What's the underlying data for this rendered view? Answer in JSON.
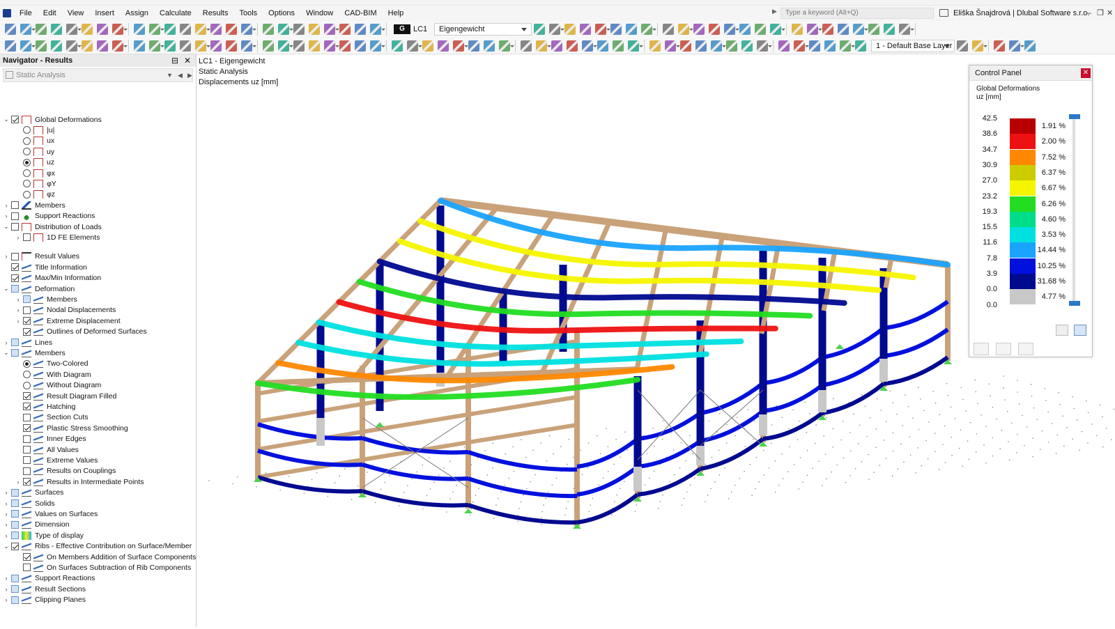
{
  "menubar": {
    "items": [
      "File",
      "Edit",
      "View",
      "Insert",
      "Assign",
      "Calculate",
      "Results",
      "Tools",
      "Options",
      "Window",
      "CAD-BIM",
      "Help"
    ],
    "search_placeholder": "Type a keyword (Alt+Q)",
    "user": "Eliška Šnajdrová | Dlubal Software s.r.o."
  },
  "toolbar": {
    "lc_group": "G",
    "lc_code": "LC1",
    "lc_name": "Eigengewicht",
    "layer": "1 - Default Base Layer"
  },
  "navigator": {
    "title": "Navigator - Results",
    "analysis": "Static Analysis",
    "tree": [
      {
        "label": "Global Deformations",
        "level": 0,
        "exp": "v",
        "ctl": "cb-on",
        "icon": "deform"
      },
      {
        "label": "|u|",
        "level": 1,
        "exp": "",
        "ctl": "rb",
        "icon": "deform"
      },
      {
        "label": "ux",
        "level": 1,
        "exp": "",
        "ctl": "rb",
        "icon": "deform"
      },
      {
        "label": "uy",
        "level": 1,
        "exp": "",
        "ctl": "rb",
        "icon": "deform"
      },
      {
        "label": "uz",
        "level": 1,
        "exp": "",
        "ctl": "rb-on",
        "icon": "deform"
      },
      {
        "label": "φx",
        "level": 1,
        "exp": "",
        "ctl": "rb",
        "icon": "deform"
      },
      {
        "label": "φY",
        "level": 1,
        "exp": "",
        "ctl": "rb",
        "icon": "deform"
      },
      {
        "label": "φz",
        "level": 1,
        "exp": "",
        "ctl": "rb",
        "icon": "deform"
      },
      {
        "label": "Members",
        "level": 0,
        "exp": ">",
        "ctl": "cb",
        "icon": "mem"
      },
      {
        "label": "Support Reactions",
        "level": 0,
        "exp": ">",
        "ctl": "cb",
        "icon": "supp"
      },
      {
        "label": "Distribution of Loads",
        "level": 0,
        "exp": "v",
        "ctl": "cb",
        "icon": "deform"
      },
      {
        "label": "1D FE Elements",
        "level": 1,
        "exp": ">",
        "ctl": "cb",
        "icon": "deform"
      },
      {
        "label": "Result Values",
        "level": 0,
        "exp": ">",
        "ctl": "cb",
        "icon": "rv",
        "gap": true
      },
      {
        "label": "Title Information",
        "level": 0,
        "exp": "",
        "ctl": "cb-on",
        "icon": "gen"
      },
      {
        "label": "Max/Min Information",
        "level": 0,
        "exp": "",
        "ctl": "cb-on",
        "icon": "gen"
      },
      {
        "label": "Deformation",
        "level": 0,
        "exp": "v",
        "ctl": "cb-mixed",
        "icon": "gen"
      },
      {
        "label": "Members",
        "level": 1,
        "exp": ">",
        "ctl": "cb-mixed",
        "icon": "gen"
      },
      {
        "label": "Nodal Displacements",
        "level": 1,
        "exp": ">",
        "ctl": "cb",
        "icon": "gen"
      },
      {
        "label": "Extreme Displacement",
        "level": 1,
        "exp": ">",
        "ctl": "cb-on",
        "icon": "gen"
      },
      {
        "label": "Outlines of Deformed Surfaces",
        "level": 1,
        "exp": "",
        "ctl": "cb-on",
        "icon": "gen"
      },
      {
        "label": "Lines",
        "level": 0,
        "exp": ">",
        "ctl": "cb-mixed",
        "icon": "gen"
      },
      {
        "label": "Members",
        "level": 0,
        "exp": "v",
        "ctl": "cb-mixed",
        "icon": "gen"
      },
      {
        "label": "Two-Colored",
        "level": 1,
        "exp": "",
        "ctl": "rb-on",
        "icon": "gen"
      },
      {
        "label": "With Diagram",
        "level": 1,
        "exp": "",
        "ctl": "rb",
        "icon": "gen"
      },
      {
        "label": "Without Diagram",
        "level": 1,
        "exp": "",
        "ctl": "rb",
        "icon": "gen"
      },
      {
        "label": "Result Diagram Filled",
        "level": 1,
        "exp": "",
        "ctl": "cb-on",
        "icon": "gen"
      },
      {
        "label": "Hatching",
        "level": 1,
        "exp": "",
        "ctl": "cb-on",
        "icon": "gen"
      },
      {
        "label": "Section Cuts",
        "level": 1,
        "exp": "",
        "ctl": "cb",
        "icon": "gen"
      },
      {
        "label": "Plastic Stress Smoothing",
        "level": 1,
        "exp": "",
        "ctl": "cb-on",
        "icon": "gen"
      },
      {
        "label": "Inner Edges",
        "level": 1,
        "exp": "",
        "ctl": "cb",
        "icon": "gen"
      },
      {
        "label": "All Values",
        "level": 1,
        "exp": "",
        "ctl": "cb",
        "icon": "gen"
      },
      {
        "label": "Extreme Values",
        "level": 1,
        "exp": "",
        "ctl": "cb",
        "icon": "gen"
      },
      {
        "label": "Results on Couplings",
        "level": 1,
        "exp": "",
        "ctl": "cb",
        "icon": "gen"
      },
      {
        "label": "Results in Intermediate Points",
        "level": 1,
        "exp": ">",
        "ctl": "cb-on",
        "icon": "gen"
      },
      {
        "label": "Surfaces",
        "level": 0,
        "exp": ">",
        "ctl": "cb-mixed",
        "icon": "gen"
      },
      {
        "label": "Solids",
        "level": 0,
        "exp": ">",
        "ctl": "cb-mixed",
        "icon": "gen"
      },
      {
        "label": "Values on Surfaces",
        "level": 0,
        "exp": ">",
        "ctl": "cb-mixed",
        "icon": "gen"
      },
      {
        "label": "Dimension",
        "level": 0,
        "exp": ">",
        "ctl": "cb-mixed",
        "icon": "gen"
      },
      {
        "label": "Type of display",
        "level": 0,
        "exp": ">",
        "ctl": "cb-mixed",
        "icon": "type"
      },
      {
        "label": "Ribs - Effective Contribution on Surface/Member",
        "level": 0,
        "exp": "v",
        "ctl": "cb-on",
        "icon": "gen"
      },
      {
        "label": "On Members Addition of Surface Components",
        "level": 1,
        "exp": "",
        "ctl": "cb-on",
        "icon": "gen"
      },
      {
        "label": "On Surfaces Subtraction of Rib Components",
        "level": 1,
        "exp": "",
        "ctl": "cb",
        "icon": "gen"
      },
      {
        "label": "Support Reactions",
        "level": 0,
        "exp": ">",
        "ctl": "cb-mixed",
        "icon": "gen"
      },
      {
        "label": "Result Sections",
        "level": 0,
        "exp": ">",
        "ctl": "cb-mixed",
        "icon": "gen"
      },
      {
        "label": "Clipping Planes",
        "level": 0,
        "exp": ">",
        "ctl": "cb-mixed",
        "icon": "gen"
      }
    ]
  },
  "viewport": {
    "line1": "LC1 - Eigengewicht",
    "line2": "Static Analysis",
    "line3": "Displacements uz [mm]"
  },
  "control_panel": {
    "title": "Control Panel",
    "heading": "Global Deformations",
    "unit": "uz [mm]",
    "legend": [
      {
        "value": "42.5",
        "color": "#b80000",
        "pct": "1.91 %"
      },
      {
        "value": "38.6",
        "color": "#ee1111",
        "pct": "2.00 %"
      },
      {
        "value": "34.7",
        "color": "#ff8800",
        "pct": "7.52 %"
      },
      {
        "value": "30.9",
        "color": "#cccc00",
        "pct": "6.37 %"
      },
      {
        "value": "27.0",
        "color": "#f5f500",
        "pct": "6.67 %"
      },
      {
        "value": "23.2",
        "color": "#22dd22",
        "pct": "6.26 %"
      },
      {
        "value": "19.3",
        "color": "#00dd88",
        "pct": "4.60 %"
      },
      {
        "value": "15.5",
        "color": "#00e0e0",
        "pct": "3.53 %"
      },
      {
        "value": "11.6",
        "color": "#1aa3ff",
        "pct": "14.44 %"
      },
      {
        "value": "7.8",
        "color": "#0011dd",
        "pct": "10.25 %"
      },
      {
        "value": "3.9",
        "color": "#000a8f",
        "pct": "31.68 %"
      },
      {
        "value": "0.0",
        "color": "#c8c8c8",
        "pct": "4.77 %"
      },
      {
        "value": "0.0",
        "color": "",
        "pct": ""
      }
    ]
  }
}
